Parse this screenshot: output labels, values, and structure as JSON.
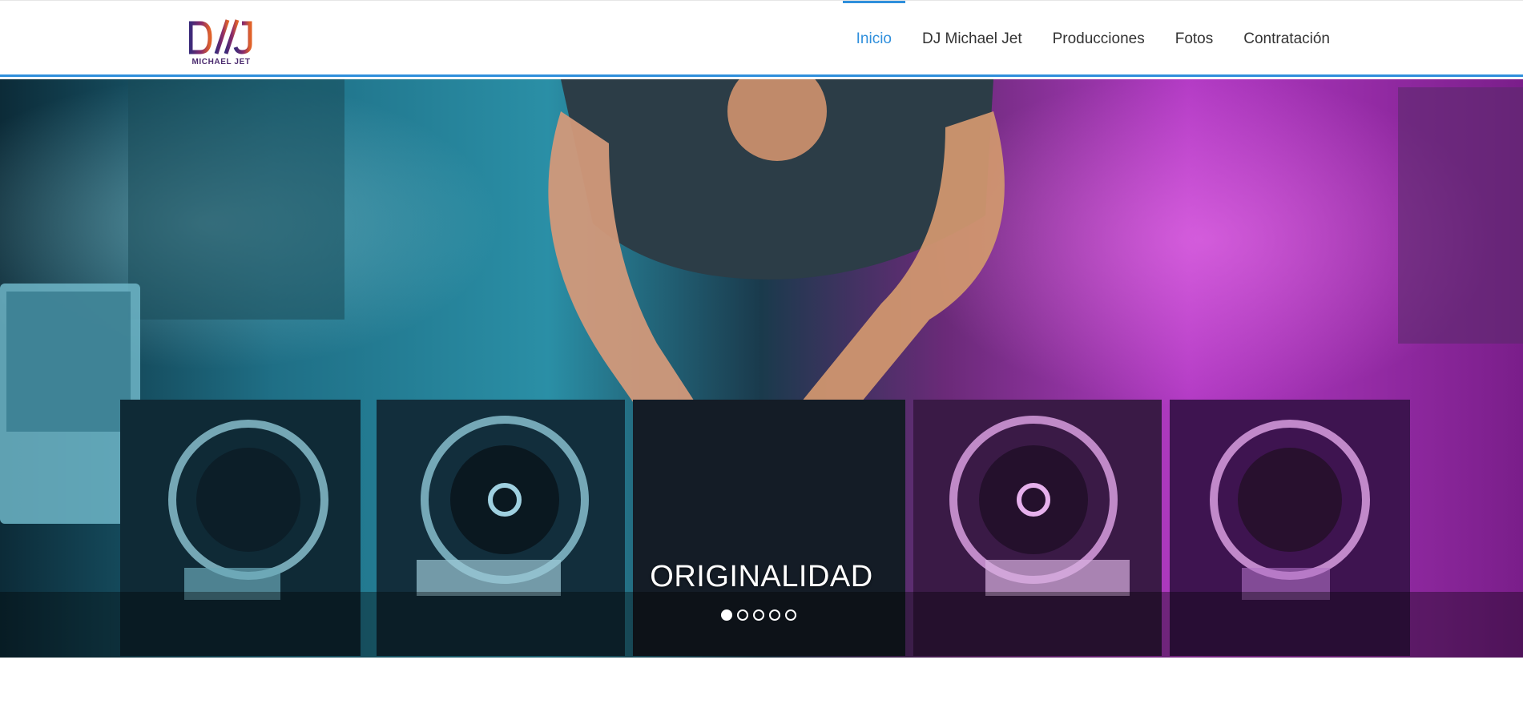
{
  "header": {
    "logo": {
      "mark": "DJ",
      "subtitle": "MICHAEL JET"
    },
    "nav": [
      {
        "label": "Inicio",
        "active": true
      },
      {
        "label": "DJ Michael Jet",
        "active": false
      },
      {
        "label": "Producciones",
        "active": false
      },
      {
        "label": "Fotos",
        "active": false
      },
      {
        "label": "Contratación",
        "active": false
      }
    ]
  },
  "hero": {
    "caption": "ORIGINALIDAD",
    "slides_total": 5,
    "active_slide": 1
  },
  "colors": {
    "accent": "#2f8fdc",
    "nav_text": "#333333",
    "logo_purple": "#4a2a6e",
    "logo_orange": "#e0622a"
  }
}
